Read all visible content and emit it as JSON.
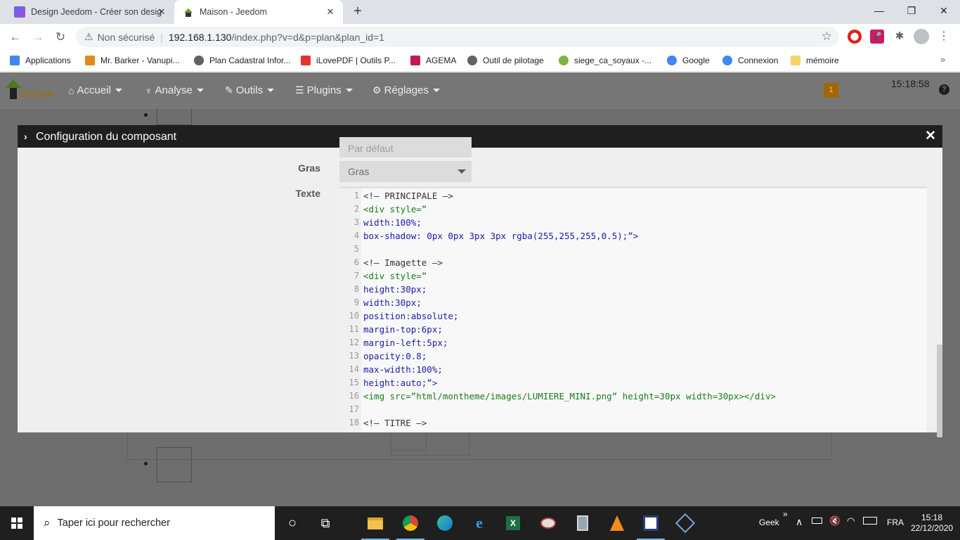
{
  "browser": {
    "tabs": [
      {
        "title": "Design Jeedom - Créer son desig",
        "close": "✕"
      },
      {
        "title": "Maison - Jeedom",
        "close": "✕"
      }
    ],
    "new_tab": "+",
    "window": {
      "minimize": "—",
      "maximize": "❐",
      "close": "✕"
    },
    "nav": {
      "back": "←",
      "forward": "→",
      "reload": "↻"
    },
    "address": {
      "warning_icon": "⚠",
      "insecure_label": "Non sécurisé",
      "separator": "|",
      "host": "192.168.1.130",
      "path": "/index.php?v=d&p=plan&plan_id=1"
    },
    "extensions": {
      "stop": "⬤",
      "mic": "🎤",
      "puzzle": "✱",
      "menu": "⋮"
    },
    "bookmarks": [
      {
        "label": "Applications",
        "color": "#4285f4"
      },
      {
        "label": "Mr. Barker - Vanupi...",
        "color": "#e08a1f"
      },
      {
        "label": "Plan Cadastral Infor...",
        "color": "#5f6368"
      },
      {
        "label": "iLovePDF | Outils P...",
        "color": "#e5322d"
      },
      {
        "label": "AGEMA",
        "color": "#c2185b"
      },
      {
        "label": "Outil de pilotage",
        "color": "#5f6368"
      },
      {
        "label": "siege_ca_soyaux -...",
        "color": "#7cb342"
      },
      {
        "label": "Google",
        "color": "#4285f4"
      },
      {
        "label": "Connexion",
        "color": "#4285f4"
      },
      {
        "label": "mémoire",
        "color": "#f6d365"
      }
    ],
    "bookmarks_more": "»"
  },
  "jeedom": {
    "logo_text": "EEDOM",
    "menu": [
      {
        "icon": "⌂",
        "label": "Accueil"
      },
      {
        "icon": "♆",
        "label": "Analyse"
      },
      {
        "icon": "✎",
        "label": "Outils"
      },
      {
        "icon": "☰",
        "label": "Plugins"
      },
      {
        "icon": "⚙",
        "label": "Réglages"
      }
    ],
    "notification_count": "1",
    "clock": "15:18:58",
    "help": "?"
  },
  "modal": {
    "title": "Configuration du composant",
    "chevron": "›",
    "close": "✕",
    "partial_select_value": "Par défaut",
    "fields": {
      "bold": {
        "label": "Gras",
        "value": "Gras"
      },
      "text": {
        "label": "Texte"
      }
    },
    "code_lines": [
      {
        "n": "1",
        "text": "<!– PRINCIPALE –>",
        "kind": "comment"
      },
      {
        "n": "2",
        "text": "<div style=”",
        "kind": "tag"
      },
      {
        "n": "3",
        "text": "width:100%;",
        "kind": "prop"
      },
      {
        "n": "4",
        "text": "box-shadow: 0px 0px 3px 3px rgba(255,255,255,0.5);”>",
        "kind": "prop"
      },
      {
        "n": "5",
        "text": "",
        "kind": "comment"
      },
      {
        "n": "6",
        "text": "<!– Imagette –>",
        "kind": "comment"
      },
      {
        "n": "7",
        "text": "<div style=”",
        "kind": "tag"
      },
      {
        "n": "8",
        "text": "height:30px;",
        "kind": "prop"
      },
      {
        "n": "9",
        "text": "width:30px;",
        "kind": "prop"
      },
      {
        "n": "10",
        "text": "position:absolute;",
        "kind": "prop"
      },
      {
        "n": "11",
        "text": "margin-top:6px;",
        "kind": "prop"
      },
      {
        "n": "12",
        "text": "margin-left:5px;",
        "kind": "prop"
      },
      {
        "n": "13",
        "text": "opacity:0.8;",
        "kind": "prop"
      },
      {
        "n": "14",
        "text": "max-width:100%;",
        "kind": "prop"
      },
      {
        "n": "15",
        "text": "height:auto;”>",
        "kind": "prop"
      },
      {
        "n": "16",
        "text": "<img src=”html/montheme/images/LUMIERE_MINI.png” height=30px width=30px></div>",
        "kind": "img"
      },
      {
        "n": "17",
        "text": "",
        "kind": "comment"
      },
      {
        "n": "18",
        "text": "<!– TITRE –>",
        "kind": "comment"
      }
    ]
  },
  "taskbar": {
    "search_placeholder": "Taper ici pour rechercher",
    "search_icon": "⌕",
    "cortana": "○",
    "task_view": "⧉",
    "tray_label": "Geek",
    "tray_chevron": "»",
    "tray_up": "∧",
    "language": "FRA",
    "time": "15:18",
    "date": "22/12/2020"
  }
}
